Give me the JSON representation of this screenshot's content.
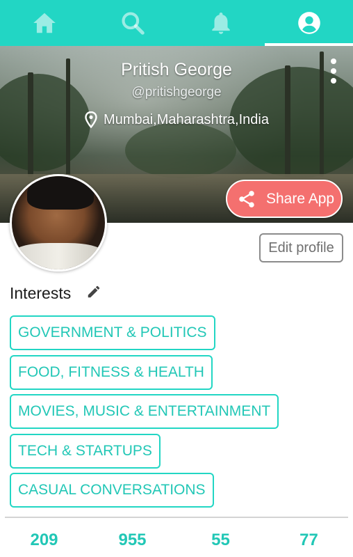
{
  "nav": {
    "tabs": [
      {
        "icon": "home-icon",
        "active": false
      },
      {
        "icon": "search-icon",
        "active": false
      },
      {
        "icon": "bell-icon",
        "active": false
      },
      {
        "icon": "profile-icon",
        "active": true
      }
    ],
    "accent": "#22d6c4"
  },
  "profile": {
    "name": "Pritish George",
    "handle": "@pritishgeorge",
    "location": "Mumbai,Maharashtra,India",
    "share_label": "Share App",
    "edit_label": "Edit profile"
  },
  "interests": {
    "title": "Interests",
    "items": [
      "GOVERNMENT & POLITICS",
      "FOOD, FITNESS & HEALTH",
      "MOVIES, MUSIC & ENTERTAINMENT",
      "TECH & STARTUPS",
      "CASUAL CONVERSATIONS"
    ]
  },
  "stats": [
    {
      "value": "209"
    },
    {
      "value": "955"
    },
    {
      "value": "55"
    },
    {
      "value": "77"
    }
  ],
  "colors": {
    "share_button": "#f4706f",
    "chip_border": "#22d6c4"
  }
}
